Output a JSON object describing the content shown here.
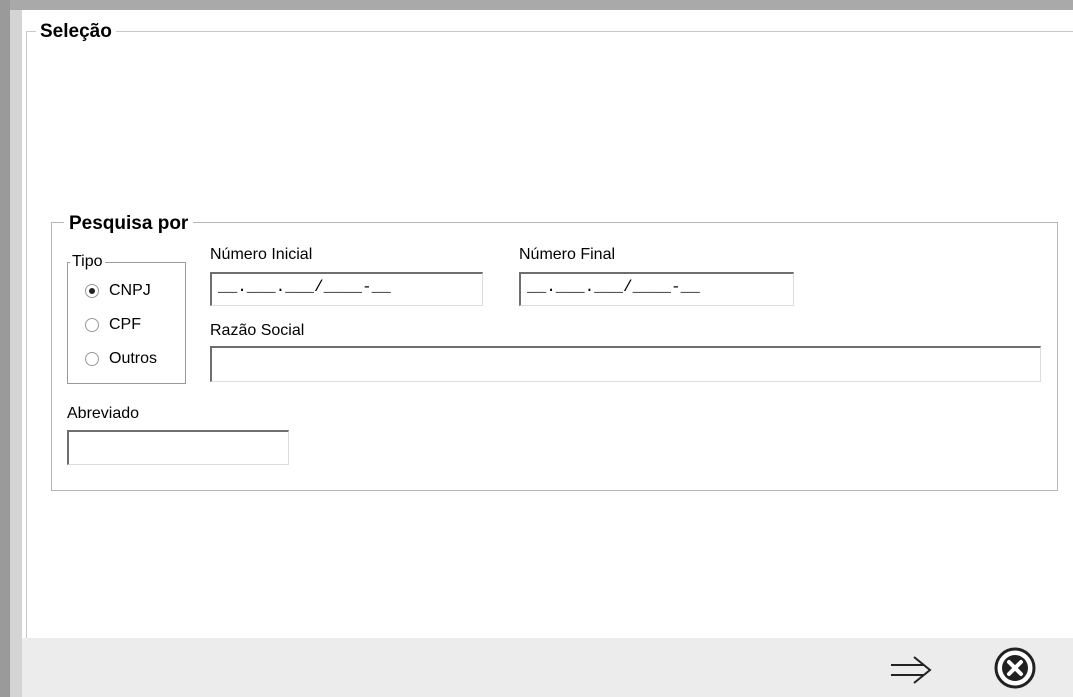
{
  "selecao": {
    "title": "Seleção"
  },
  "pesquisa": {
    "title": "Pesquisa por",
    "tipo": {
      "label": "Tipo",
      "options": [
        {
          "label": "CNPJ",
          "selected": true
        },
        {
          "label": "CPF",
          "selected": false
        },
        {
          "label": "Outros",
          "selected": false
        }
      ]
    },
    "numero_inicial": {
      "label": "Número Inicial",
      "value": "__.___.___/____-__"
    },
    "numero_final": {
      "label": "Número Final",
      "value": "__.___.___/____-__"
    },
    "razao_social": {
      "label": "Razão Social",
      "value": ""
    },
    "abreviado": {
      "label": "Abreviado",
      "value": ""
    }
  },
  "actions": {
    "next_icon": "arrow-right-icon",
    "close_icon": "close-circle-icon"
  }
}
